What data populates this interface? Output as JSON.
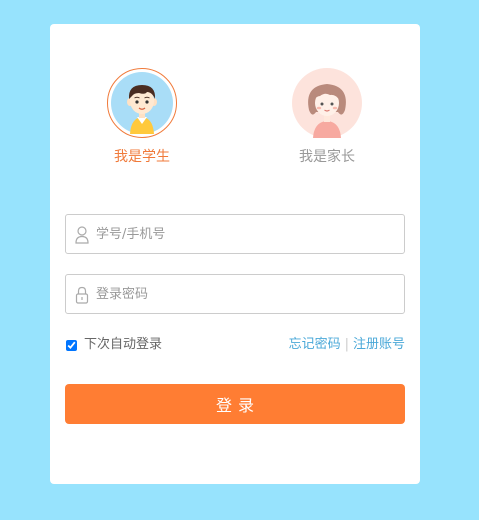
{
  "roles": {
    "student_label": "我是学生",
    "parent_label": "我是家长",
    "selected": "student"
  },
  "form": {
    "account_placeholder": "学号/手机号",
    "password_placeholder": "登录密码",
    "remember_label": "下次自动登录",
    "remember_checked": true,
    "forgot_label": "忘记密码",
    "separator": "|",
    "register_label": "注册账号",
    "login_label": "登录"
  },
  "colors": {
    "background": "#97e3fd",
    "accent": "#ff7d33",
    "link": "#4aa8d8"
  }
}
